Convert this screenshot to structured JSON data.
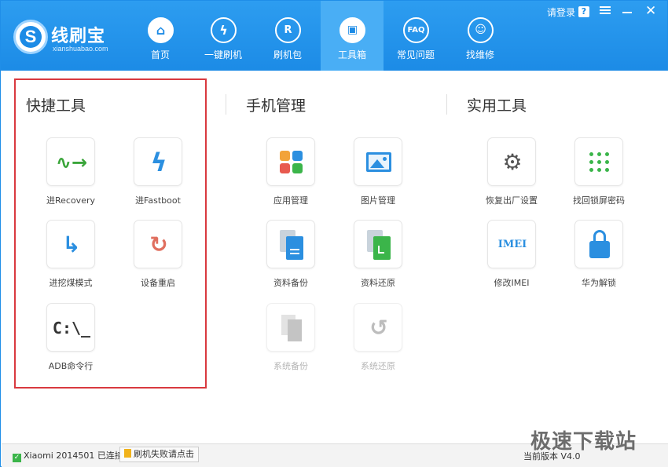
{
  "app": {
    "title": "线刷宝",
    "subtitle": "xianshuabao.com"
  },
  "nav": [
    {
      "label": "首页",
      "icon": "home-icon"
    },
    {
      "label": "一键刷机",
      "icon": "lightning-icon"
    },
    {
      "label": "刷机包",
      "icon": "rom-package-icon"
    },
    {
      "label": "工具箱",
      "icon": "toolbox-icon",
      "active": true
    },
    {
      "label": "常见问题",
      "icon": "faq-icon",
      "glyph": "FAQ"
    },
    {
      "label": "找维修",
      "icon": "repair-person-icon"
    }
  ],
  "window": {
    "login": "请登录",
    "help": "?"
  },
  "sections": {
    "quick": "快捷工具",
    "phone": "手机管理",
    "utility": "实用工具"
  },
  "tools": {
    "recovery": "进Recovery",
    "fastboot": "进Fastboot",
    "edl": "进挖煤模式",
    "reboot": "设备重启",
    "adb": "ADB命令行",
    "adb_glyph": "C:\\_",
    "apps": "应用管理",
    "images": "图片管理",
    "backup": "资料备份",
    "restore": "资料还原",
    "sys_backup": "系统备份",
    "sys_restore": "系统还原",
    "factory": "恢复出厂设置",
    "unlock_pattern": "找回锁屏密码",
    "imei": "修改IMEI",
    "imei_glyph": "IMEI",
    "huawei_unlock": "华为解锁"
  },
  "status": {
    "device": "Xiaomi 2014501 已连接",
    "fail_button": "刷机失败请点击",
    "version": "当前版本 V4.0"
  },
  "watermark": "极速下载站",
  "colors": {
    "header": "#1c8be6",
    "active_nav": "#49aef5",
    "highlight_border": "#d9393f",
    "green": "#3bb54a",
    "orange": "#f1b21a"
  }
}
